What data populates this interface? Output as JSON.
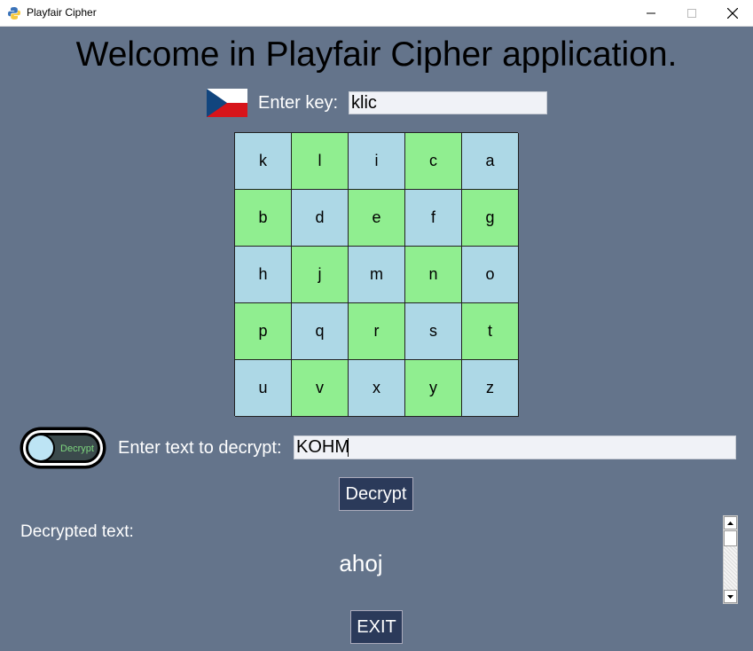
{
  "window": {
    "title": "Playfair Cipher"
  },
  "header": {
    "title": "Welcome in Playfair Cipher application."
  },
  "key": {
    "label": "Enter key:",
    "value": "klic"
  },
  "grid": {
    "rows": [
      [
        "k",
        "l",
        "i",
        "c",
        "a"
      ],
      [
        "b",
        "d",
        "e",
        "f",
        "g"
      ],
      [
        "h",
        "j",
        "m",
        "n",
        "o"
      ],
      [
        "p",
        "q",
        "r",
        "s",
        "t"
      ],
      [
        "u",
        "v",
        "x",
        "y",
        "z"
      ]
    ],
    "colors": {
      "blue": "#add8e6",
      "green": "#90ee90"
    }
  },
  "mode": {
    "toggle_text": "Decrypt"
  },
  "input": {
    "label": "Enter text to decrypt:",
    "value": "KOHM"
  },
  "actions": {
    "decrypt_label": "Decrypt",
    "exit_label": "EXIT"
  },
  "result": {
    "label": "Decrypted text:",
    "value": "ahoj"
  },
  "theme": {
    "background": "#64748b",
    "button": "#2b3a5a"
  }
}
